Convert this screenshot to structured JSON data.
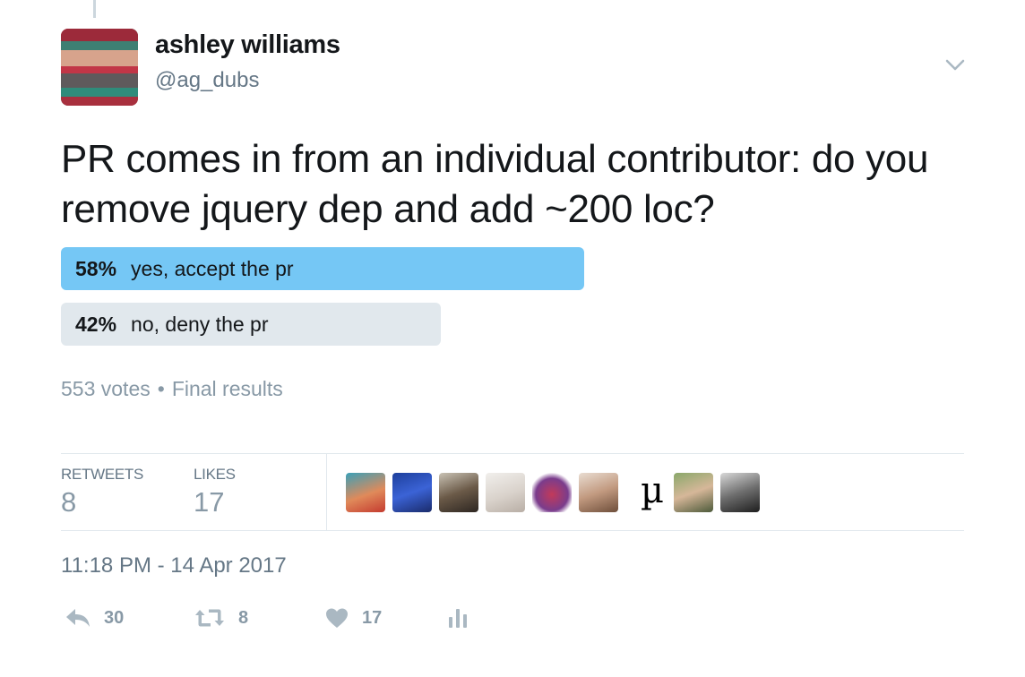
{
  "author": {
    "name": "ashley williams",
    "handle": "@ag_dubs"
  },
  "tweet": {
    "text": "PR comes in from an individual contributor: do you remove jquery dep and add ~200 loc?"
  },
  "poll": {
    "options": [
      {
        "percent": "58%",
        "label": "yes, accept the pr",
        "share": 0.58,
        "leading": true
      },
      {
        "percent": "42%",
        "label": "no, deny the pr",
        "share": 0.42,
        "leading": false
      }
    ],
    "votes": "553 votes",
    "separator": "•",
    "status": "Final results"
  },
  "stats": {
    "retweets_label": "RETWEETS",
    "retweets_value": "8",
    "likes_label": "LIKES",
    "likes_value": "17"
  },
  "likers": [
    {
      "icon": "liker-avatar-1"
    },
    {
      "icon": "liker-avatar-2"
    },
    {
      "icon": "liker-avatar-3"
    },
    {
      "icon": "liker-avatar-4"
    },
    {
      "icon": "liker-avatar-5"
    },
    {
      "icon": "liker-avatar-6"
    },
    {
      "icon": "liker-avatar-mu",
      "glyph": "µ"
    },
    {
      "icon": "liker-avatar-8"
    },
    {
      "icon": "liker-avatar-9"
    }
  ],
  "timestamp": "11:18 PM - 14 Apr 2017",
  "actions": {
    "reply_count": "30",
    "retweet_count": "8",
    "like_count": "17"
  },
  "colors": {
    "poll_leading": "#75c7f5",
    "poll_other": "#e1e8ed",
    "muted": "#8899a6"
  }
}
